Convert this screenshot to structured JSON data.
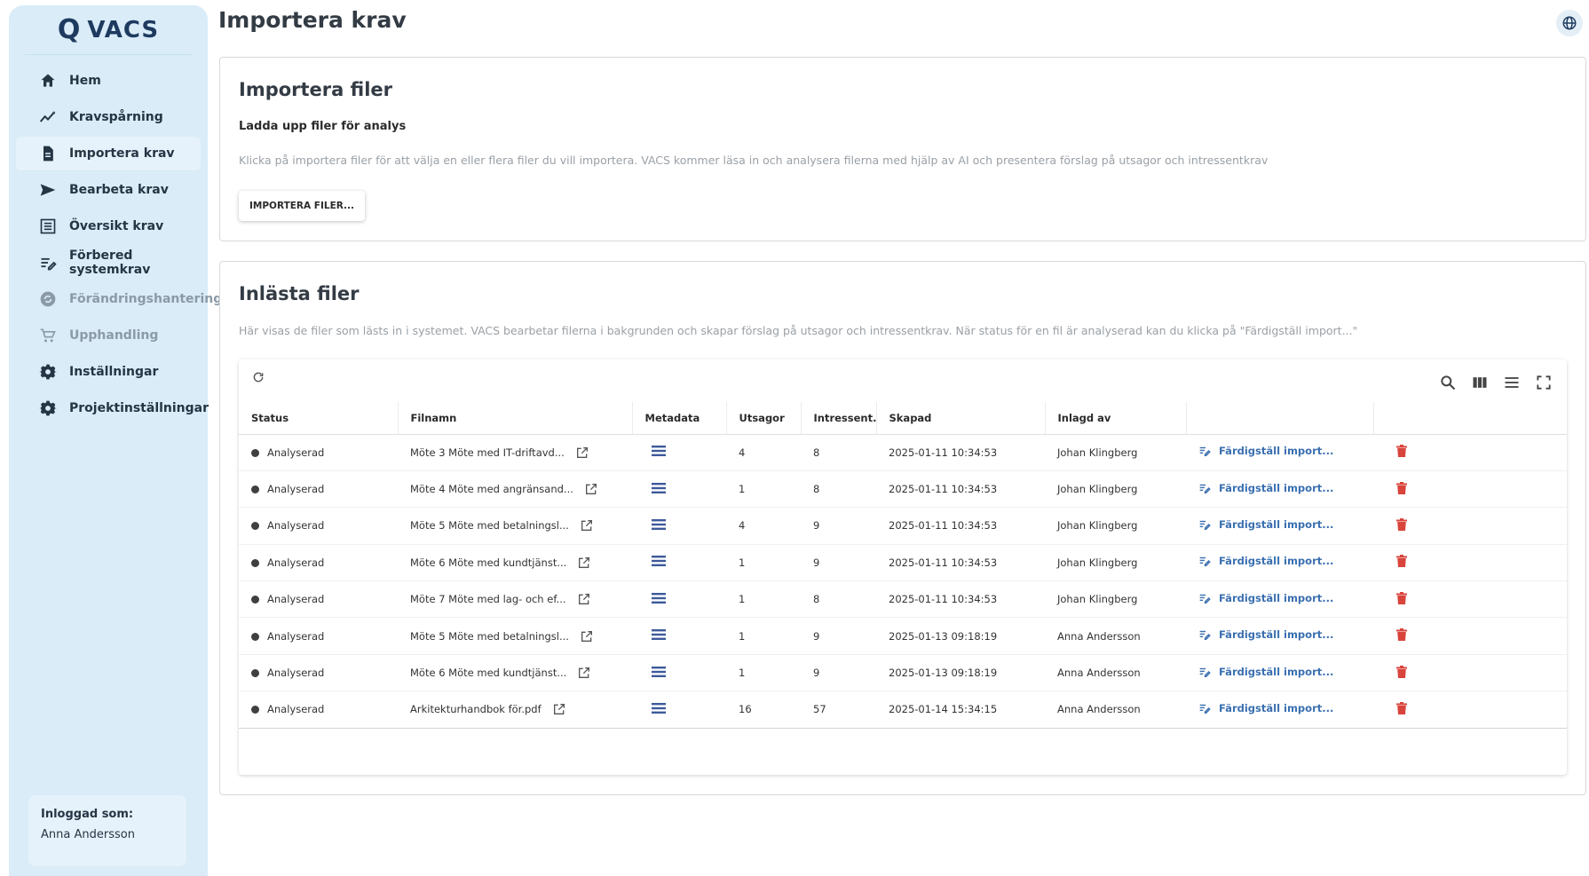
{
  "app": {
    "logo_mark": "Q",
    "logo_text": "VACS"
  },
  "page": {
    "title": "Importera krav"
  },
  "sidebar": {
    "items": [
      {
        "label": "Hem",
        "icon": "home-icon",
        "state": "normal"
      },
      {
        "label": "Kravspårning",
        "icon": "trend-icon",
        "state": "normal"
      },
      {
        "label": "Importera krav",
        "icon": "document-icon",
        "state": "active"
      },
      {
        "label": "Bearbeta krav",
        "icon": "send-icon",
        "state": "normal"
      },
      {
        "label": "Översikt krav",
        "icon": "list-icon",
        "state": "normal"
      },
      {
        "label": "Förbered systemkrav",
        "icon": "edit-list-icon",
        "state": "normal"
      },
      {
        "label": "Förändringshantering",
        "icon": "change-icon",
        "state": "disabled"
      },
      {
        "label": "Upphandling",
        "icon": "cart-icon",
        "state": "disabled"
      },
      {
        "label": "Inställningar",
        "icon": "gear-icon",
        "state": "normal"
      },
      {
        "label": "Projektinställningar",
        "icon": "gear-icon",
        "state": "normal"
      }
    ],
    "login": {
      "label": "Inloggad som:",
      "user": "Anna Andersson"
    }
  },
  "import_card": {
    "title": "Importera filer",
    "subtitle": "Ladda upp filer för analys",
    "description": "Klicka på importera filer för att välja en eller flera filer du vill importera. VACS kommer läsa in och analysera filerna med hjälp av AI och presentera förslag på utsagor och intressentkrav",
    "button_label": "IMPORTERA FILER..."
  },
  "files_card": {
    "title": "Inlästa filer",
    "description": "Här visas de filer som lästs in i systemet. VACS bearbetar filerna i bakgrunden och skapar förslag på utsagor och intressentkrav. När status för en fil är analyserad kan du klicka på \"Färdigställ import...\"",
    "columns": [
      "Status",
      "Filnamn",
      "Metadata",
      "Utsagor",
      "Intressent...",
      "Skapad",
      "Inlagd av",
      "",
      ""
    ],
    "rows": [
      {
        "status": "Analyserad",
        "filename": "Möte 3 Möte med IT-driftavd...",
        "utsagor": "4",
        "intressent": "8",
        "skapad": "2025-01-11 10:34:53",
        "inlagd_av": "Johan Klingberg",
        "action": "Färdigställ import..."
      },
      {
        "status": "Analyserad",
        "filename": "Möte 4 Möte med angränsand...",
        "utsagor": "1",
        "intressent": "8",
        "skapad": "2025-01-11 10:34:53",
        "inlagd_av": "Johan Klingberg",
        "action": "Färdigställ import..."
      },
      {
        "status": "Analyserad",
        "filename": "Möte 5 Möte med betalningsl...",
        "utsagor": "4",
        "intressent": "9",
        "skapad": "2025-01-11 10:34:53",
        "inlagd_av": "Johan Klingberg",
        "action": "Färdigställ import..."
      },
      {
        "status": "Analyserad",
        "filename": "Möte 6 Möte med kundtjänst...",
        "utsagor": "1",
        "intressent": "9",
        "skapad": "2025-01-11 10:34:53",
        "inlagd_av": "Johan Klingberg",
        "action": "Färdigställ import..."
      },
      {
        "status": "Analyserad",
        "filename": "Möte 7 Möte med lag- och ef...",
        "utsagor": "1",
        "intressent": "8",
        "skapad": "2025-01-11 10:34:53",
        "inlagd_av": "Johan Klingberg",
        "action": "Färdigställ import..."
      },
      {
        "status": "Analyserad",
        "filename": "Möte 5 Möte med betalningsl...",
        "utsagor": "1",
        "intressent": "9",
        "skapad": "2025-01-13 09:18:19",
        "inlagd_av": "Anna Andersson",
        "action": "Färdigställ import..."
      },
      {
        "status": "Analyserad",
        "filename": "Möte 6 Möte med kundtjänst...",
        "utsagor": "1",
        "intressent": "9",
        "skapad": "2025-01-13 09:18:19",
        "inlagd_av": "Anna Andersson",
        "action": "Färdigställ import..."
      },
      {
        "status": "Analyserad",
        "filename": "Arkitekturhandbok för.pdf",
        "utsagor": "16",
        "intressent": "57",
        "skapad": "2025-01-14 15:34:15",
        "inlagd_av": "Anna Andersson",
        "action": "Färdigställ import..."
      }
    ]
  },
  "colors": {
    "sidebar_bg": "#d9ecf8",
    "link": "#3a6fb0",
    "delete": "#d9443c",
    "metadata_icon": "#3d5a9a"
  }
}
